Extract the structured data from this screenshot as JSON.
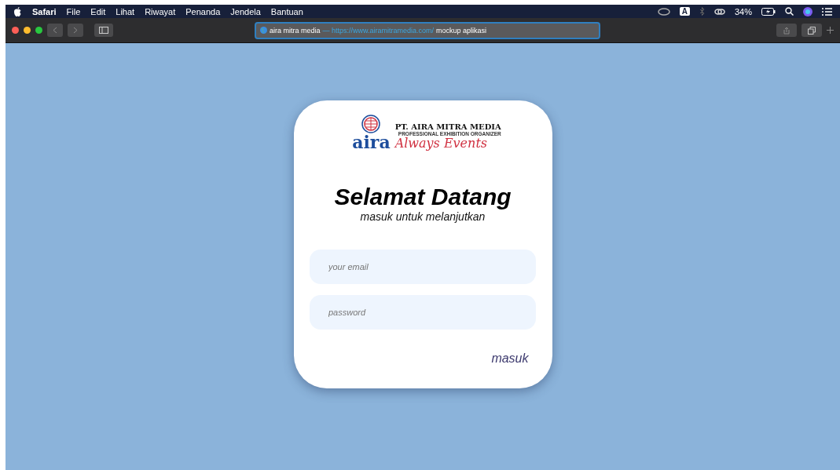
{
  "menu_bar": {
    "app": "Safari",
    "items": [
      "File",
      "Edit",
      "Lihat",
      "Riwayat",
      "Penanda",
      "Jendela",
      "Bantuan"
    ],
    "input_badge": "A",
    "battery": "34%"
  },
  "toolbar": {
    "address": {
      "site": "aira mitra media",
      "separator": "—",
      "url": "https://www.airamitramedia.com/",
      "path": "mockup aplikasi"
    }
  },
  "logo": {
    "wordmark": "aira",
    "company": "PT. AIRA MITRA MEDIA",
    "tagline": "PROFESSIONAL EXHIBITION ORGANIZER",
    "slogan": "Always Events"
  },
  "login": {
    "title": "Selamat Datang",
    "subtitle": "masuk untuk melanjutkan",
    "fields": [
      {
        "placeholder": "your email"
      },
      {
        "placeholder": "password"
      }
    ],
    "submit": "masuk"
  }
}
